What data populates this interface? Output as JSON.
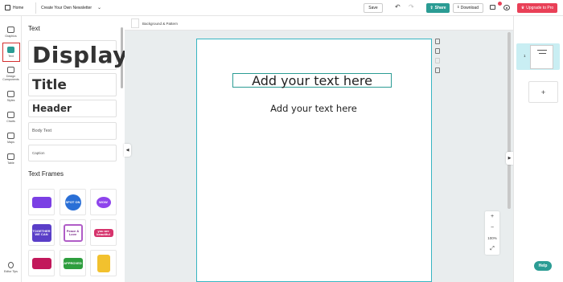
{
  "topbar": {
    "home_label": "Home",
    "doc_name": "Create Your Own Newsletter",
    "save_label": "Save",
    "share_label": "Share",
    "download_label": "Download",
    "upgrade_label": "Upgrade to Pro"
  },
  "rail": {
    "items": [
      {
        "label": "Graphics",
        "icon": "graphics-icon"
      },
      {
        "label": "Text",
        "icon": "text-icon"
      },
      {
        "label": "Design Components",
        "icon": "design-components-icon"
      },
      {
        "label": "Styles",
        "icon": "styles-icon"
      },
      {
        "label": "Charts",
        "icon": "charts-icon"
      },
      {
        "label": "Maps",
        "icon": "maps-icon"
      },
      {
        "label": "Table",
        "icon": "table-icon"
      }
    ],
    "editor_tips": "Editor Tips"
  },
  "panel": {
    "title": "Text",
    "styles": {
      "display": "Display",
      "title": "Title",
      "header": "Header",
      "body": "Body Text",
      "caption": "Caption"
    },
    "frames_title": "Text Frames",
    "frames": [
      {
        "text": "",
        "color": "#7b3fe4"
      },
      {
        "text": "SPOT ON",
        "color": "#2a6fd6"
      },
      {
        "text": "WOW",
        "color": "#8e44ec"
      },
      {
        "text": "TOGETHER WE CAN",
        "color": "#5a3ec8"
      },
      {
        "text": "Peace & Love",
        "color": "#e9a7c7"
      },
      {
        "text": "you are beautiful",
        "color": "#d6336c"
      },
      {
        "text": "",
        "color": "#c2185b"
      },
      {
        "text": "APPROVED",
        "color": "#2e9e3e"
      },
      {
        "text": "",
        "color": "#f2c12e"
      }
    ]
  },
  "canvas": {
    "bg_label": "Background & Pattern",
    "heading_text": "Add your text here",
    "sub_text": "Add your text here",
    "zoom_label": "100%"
  },
  "pages": {
    "page_number": "1"
  },
  "help_label": "Help",
  "colors": {
    "accent": "#2b9c94",
    "upgrade": "#e94057",
    "page_border": "#37b5c2"
  }
}
